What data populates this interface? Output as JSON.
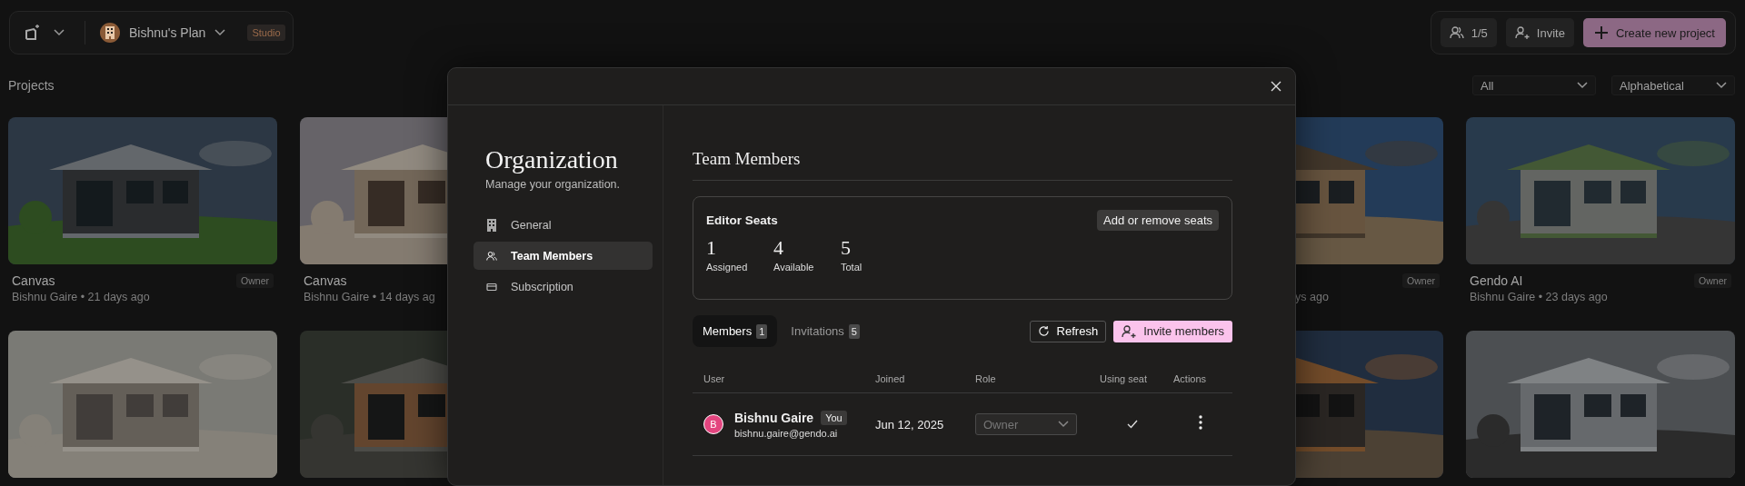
{
  "header": {
    "plan_name": "Bishnu's Plan",
    "plan_badge": "Studio",
    "seats": "1/5",
    "invite": "Invite",
    "create": "Create new project"
  },
  "projects": {
    "title": "Projects",
    "filter": "All",
    "sort": "Alphabetical",
    "left_cards": [
      {
        "kind": "full",
        "title": "Canvas",
        "meta": "Bishnu Gaire • 21 days ago",
        "role": "Owner"
      },
      {
        "kind": "cut_right",
        "title": "Canvas",
        "meta": "Bishnu Gaire • 14 days ag"
      },
      {
        "kind": "full"
      },
      {
        "kind": "cut_right"
      }
    ],
    "right_cards": [
      {
        "kind": "cut_left",
        "meta": "ys ago",
        "role": "Owner"
      },
      {
        "kind": "full",
        "title": "Gendo AI",
        "meta": "Bishnu Gaire • 23 days ago",
        "role": "Owner"
      },
      {
        "kind": "cut_left"
      },
      {
        "kind": "full"
      }
    ]
  },
  "modal": {
    "title": "Organization",
    "subtitle": "Manage your organization.",
    "nav": [
      {
        "label": "General",
        "selected": false
      },
      {
        "label": "Team Members",
        "selected": true
      },
      {
        "label": "Subscription",
        "selected": false
      }
    ],
    "section_title": "Team Members",
    "seats": {
      "title": "Editor Seats",
      "button": "Add or remove seats",
      "stats": [
        {
          "value": "1",
          "label": "Assigned"
        },
        {
          "value": "4",
          "label": "Available"
        },
        {
          "value": "5",
          "label": "Total"
        }
      ]
    },
    "tabs": [
      {
        "label": "Members",
        "count": "1",
        "selected": true
      },
      {
        "label": "Invitations",
        "count": "5",
        "selected": false
      }
    ],
    "refresh": "Refresh",
    "invite": "Invite members",
    "table": {
      "columns": [
        "User",
        "Joined",
        "Role",
        "Using seat",
        "Actions"
      ],
      "rows": [
        {
          "avatar": "B",
          "name": "Bishnu Gaire",
          "badge": "You",
          "email": "bishnu.gaire@gendo.ai",
          "joined": "Jun 12, 2025",
          "role": "Owner",
          "role_disabled": true,
          "using_seat": true
        }
      ]
    }
  }
}
